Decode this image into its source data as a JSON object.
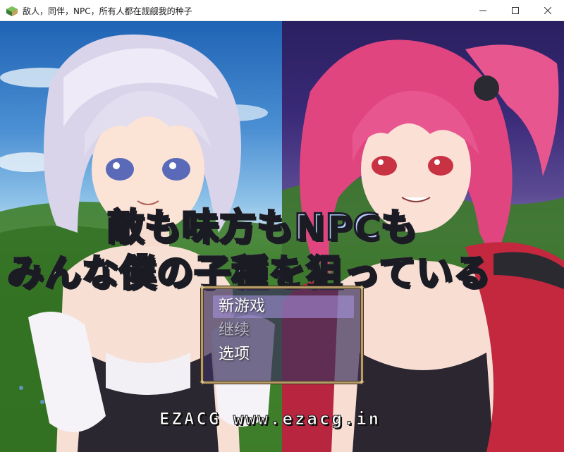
{
  "window": {
    "title": "敌人，同伴，NPC，所有人都在觊觎我的种子",
    "controls": {
      "minimize": "minimize-icon",
      "maximize": "maximize-icon",
      "close": "close-icon"
    }
  },
  "logo": {
    "line1": "敵も味方もNPCも",
    "line2": "みんな僕の子種を狙っている"
  },
  "menu": {
    "items": [
      {
        "label": "新游戏",
        "selected": true,
        "enabled": true
      },
      {
        "label": "继续",
        "selected": false,
        "enabled": false
      },
      {
        "label": "选项",
        "selected": false,
        "enabled": true
      }
    ]
  },
  "watermark": "EZACG  www.ezacg.in",
  "colors": {
    "menu_border": "#b79b66",
    "menu_bg": "#3a305c",
    "cursor": "#aa96e6",
    "disabled_text": "#b8b4c4"
  }
}
